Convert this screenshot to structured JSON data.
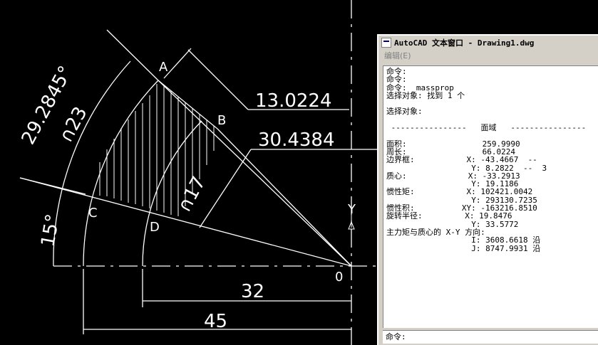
{
  "drawing": {
    "dims": {
      "angle_arc": "29.2845°",
      "chord_ab": "13.0224",
      "radius_ob": "30.4384",
      "arc_r23": "∩23",
      "arc_r17": "∩17",
      "angle_15": "15°",
      "width_32": "32",
      "width_45": "45"
    },
    "points": {
      "a": "A",
      "b": "B",
      "c": "C",
      "d": "D",
      "o": "0"
    },
    "ucs_y": "Y"
  },
  "text_window": {
    "title": "AutoCAD 文本窗口 - Drawing1.dwg",
    "menu": "编辑(E)",
    "lines": [
      "命令:",
      "命令:",
      "命令: _massprop",
      "选择对象: 找到 1 个",
      "",
      "选择对象:",
      "",
      " ----------------   面域   ----------------",
      "",
      "面积:                259.9990",
      "周长:                66.0224",
      "边界框:           X: -43.4667  --",
      "                  Y: 8.2822  --  3",
      "质心:             X: -33.2913",
      "                  Y: 19.1186",
      "惯性矩:           X: 102421.0042",
      "                  Y: 293130.7235",
      "惯性积:          XY: -163216.8510",
      "旋转半径:         X: 19.8476",
      "                  Y: 33.5772",
      "主力矩与质心的 X-Y 方向:",
      "                  I: 3608.6618 沿",
      "                  J: 8747.9931 沿"
    ],
    "command_prompt": "命令:"
  }
}
